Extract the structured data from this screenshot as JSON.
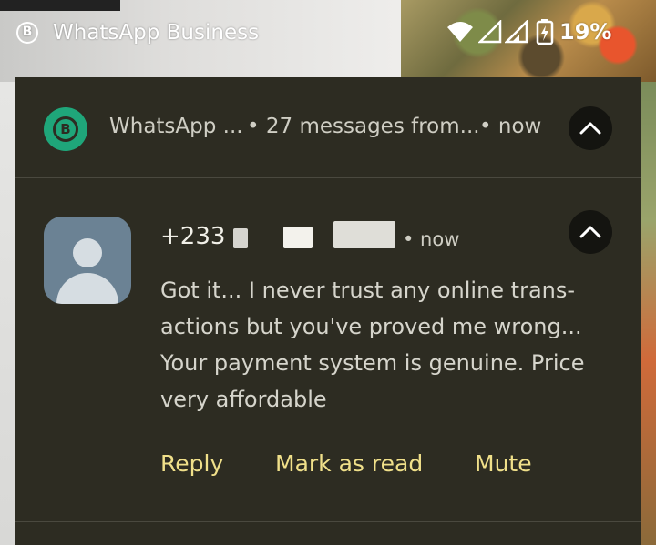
{
  "status_bar": {
    "app_name": "WhatsApp Business",
    "logo_letter": "B",
    "battery_percent": "19%",
    "icons": [
      "wifi-icon",
      "cell-signal-icon",
      "cell-signal-icon",
      "battery-charging-icon"
    ]
  },
  "notification": {
    "header": {
      "app_name": "WhatsApp ...",
      "summary": "• 27 messages from...",
      "time": "• now",
      "logo_letter": "B",
      "collapse_icon": "chevron-up-icon"
    },
    "message": {
      "sender": "+233",
      "time": "• now",
      "lines": [
        "Got it... I never trust any online trans-",
        "actions but you've proved me wrong...",
        "Your payment system is genuine. Price",
        "very affordable"
      ],
      "avatar_icon": "person-avatar-icon"
    },
    "actions": {
      "reply": "Reply",
      "mark_as_read": "Mark as read",
      "mute": "Mute"
    }
  },
  "colors": {
    "card_background": "#2d2c22",
    "action_text": "#f0e08a",
    "app_logo": "#1fa67a",
    "avatar": "#6b8294"
  }
}
